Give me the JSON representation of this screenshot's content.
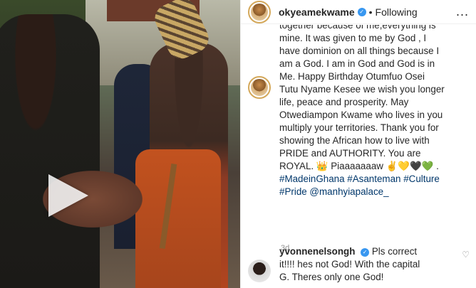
{
  "post": {
    "username": "okyeamekwame",
    "follow_state": "Following",
    "separator": "•",
    "more_label": "...",
    "caption_lines": [
      "together because of me,everything is",
      "mine. It was given to me by God , I",
      "have dominion on all things because I",
      "am a God. I am in God and God is in",
      "Me. Happy Birthday Otumfuo Osei",
      "Tutu Nyame Kesee we wish you longer",
      "life, peace and prosperity. May",
      "Otwediampon Kwame who lives in you",
      "multiply your territories. Thank you for",
      "showing the African how to live with",
      "PRIDE and AUTHORITY. You are",
      "ROYAL. 👑 Piaaaaaaaw ✌️💛🖤💚 ."
    ],
    "hashtags_line1": "#MadeinGhana #Asanteman #Culture",
    "hashtags_line2": "#Pride @manhyiapalace_",
    "age": "3d"
  },
  "reply": {
    "username": "yvonnenelsongh",
    "line1": "Pls correct",
    "line2": "it!!!! hes not God! With the capital",
    "line3": "G. Theres only one God!"
  },
  "icons": {
    "verified": "✓",
    "heart": "♡"
  },
  "colors": {
    "verified": "#3897f0",
    "link": "#00376b",
    "muted": "#8e8e8e",
    "text": "#262626"
  }
}
